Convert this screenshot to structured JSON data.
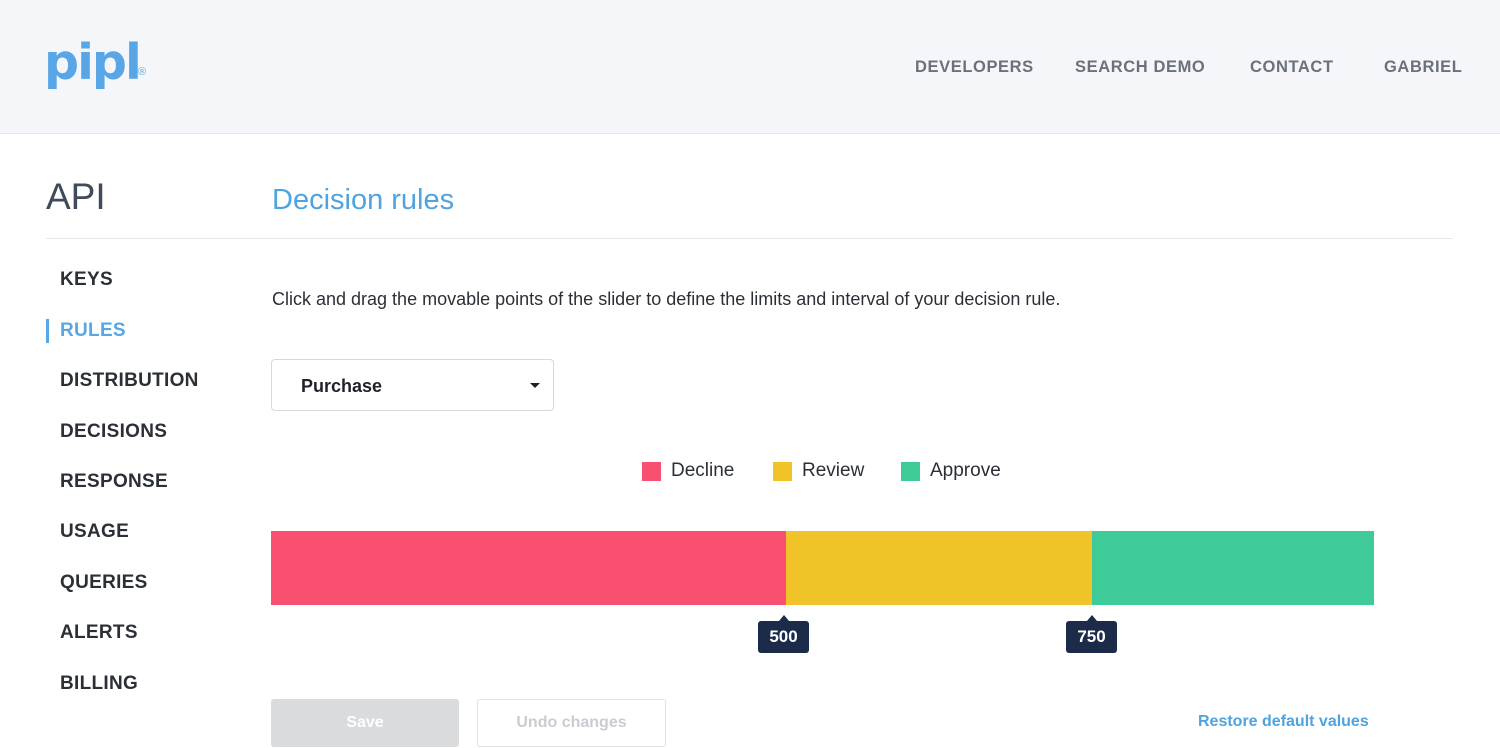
{
  "header": {
    "logo_text": "pipl",
    "logo_mark": "®",
    "nav": [
      "DEVELOPERS",
      "SEARCH DEMO",
      "CONTACT",
      "GABRIEL"
    ]
  },
  "sidebar": {
    "title": "API",
    "items": [
      "KEYS",
      "RULES",
      "DISTRIBUTION",
      "DECISIONS",
      "RESPONSE",
      "USAGE",
      "QUERIES",
      "ALERTS",
      "BILLING"
    ],
    "active": "RULES"
  },
  "main": {
    "title": "Decision rules",
    "description": "Click and drag the movable points of the slider to define the limits and interval of your decision rule.",
    "select_value": "Purchase",
    "legend": [
      {
        "label": "Decline",
        "color": "#f94f70"
      },
      {
        "label": "Review",
        "color": "#f0c328"
      },
      {
        "label": "Approve",
        "color": "#3ecb98"
      }
    ],
    "slider": {
      "handles": [
        "500",
        "750"
      ],
      "colors": {
        "decline": "#f94f70",
        "review": "#f0c328",
        "approve": "#3ecb98"
      }
    },
    "buttons": {
      "save": "Save",
      "undo": "Undo changes",
      "restore": "Restore default values"
    }
  },
  "colors": {
    "accent": "#58a6e6",
    "handle_bg": "#1c2b4a"
  }
}
